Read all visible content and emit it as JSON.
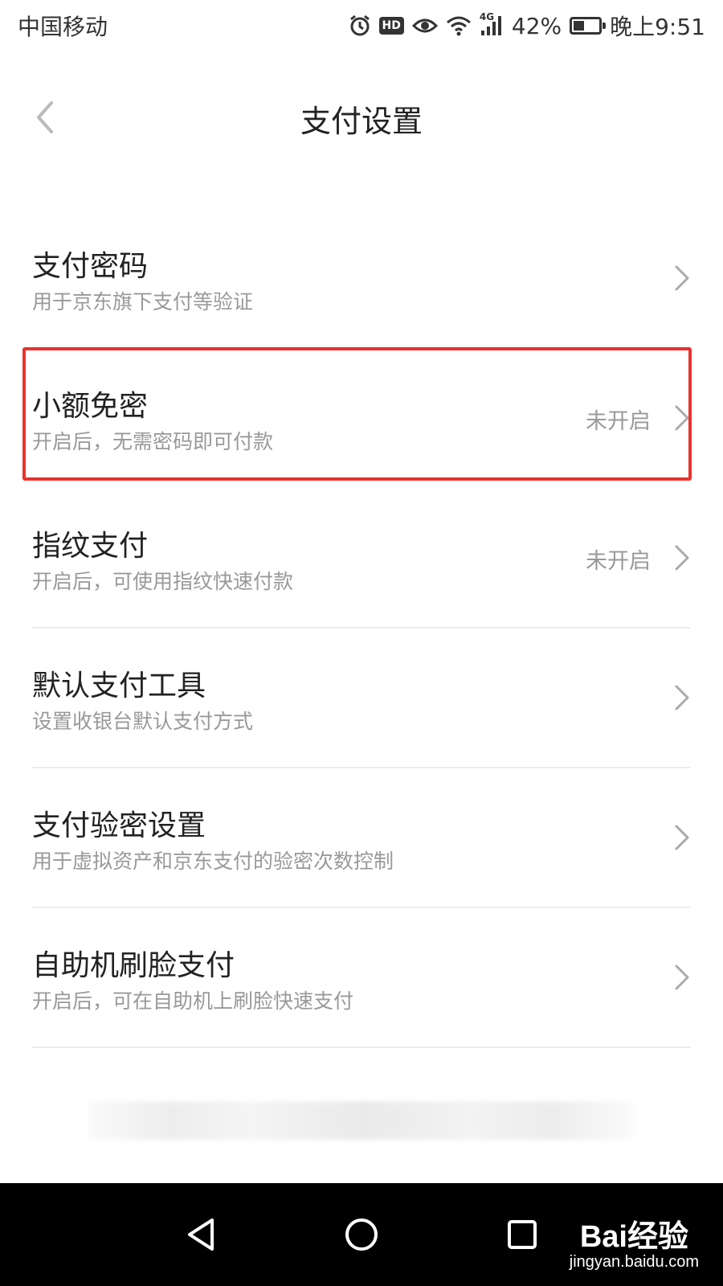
{
  "status_bar": {
    "carrier": "中国移动",
    "battery_percent": "42%",
    "battery_level": 0.42,
    "time": "晚上9:51",
    "hd_label": "HD",
    "network_label": "4G",
    "icons": [
      "alarm-icon",
      "hd-icon",
      "eye-icon",
      "wifi-icon",
      "signal-icon",
      "battery-icon"
    ]
  },
  "header": {
    "back_icon": "chevron-left-icon",
    "title": "支付设置"
  },
  "settings": [
    {
      "title": "支付密码",
      "subtitle": "用于京东旗下支付等验证",
      "status": ""
    },
    {
      "title": "小额免密",
      "subtitle": "开启后，无需密码即可付款",
      "status": "未开启"
    },
    {
      "title": "指纹支付",
      "subtitle": "开启后，可使用指纹快速付款",
      "status": "未开启"
    },
    {
      "title": "默认支付工具",
      "subtitle": "设置收银台默认支付方式",
      "status": ""
    },
    {
      "title": "支付验密设置",
      "subtitle": "用于虚拟资产和京东支付的验密次数控制",
      "status": ""
    },
    {
      "title": "自助机刷脸支付",
      "subtitle": "开启后，可在自助机上刷脸快速支付",
      "status": ""
    }
  ],
  "highlight": {
    "color": "#e8322c"
  },
  "nav_bar": {
    "icons": [
      "back-triangle-icon",
      "home-circle-icon",
      "recent-square-icon"
    ]
  },
  "watermark": {
    "logo": "Bai经验",
    "url": "jingyan.baidu.com"
  }
}
